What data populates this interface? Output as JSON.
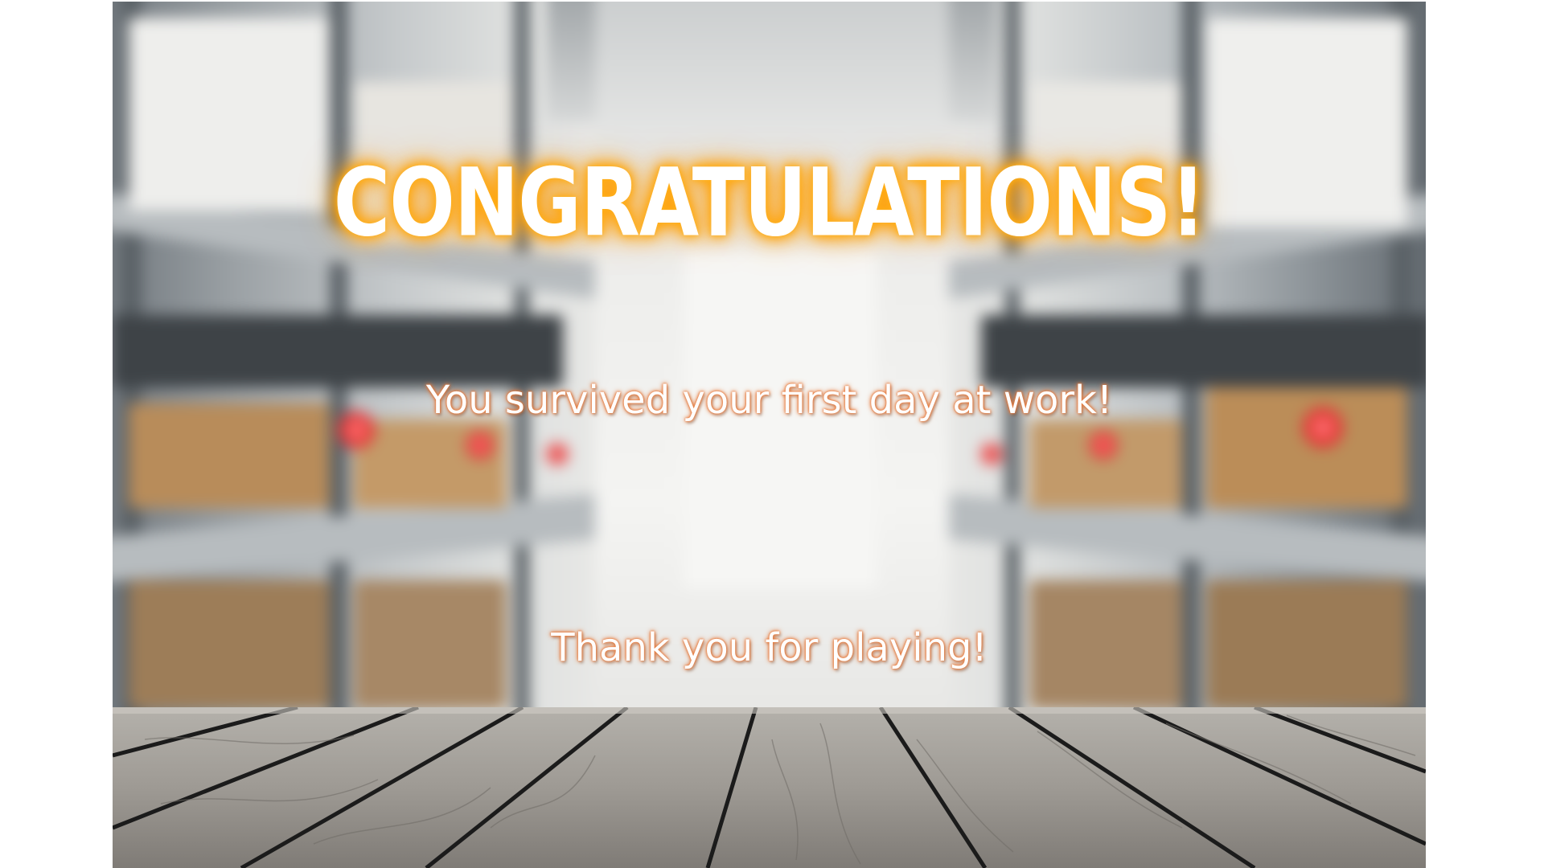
{
  "screen": {
    "title": "CONGRATULATIONS!",
    "message": "You survived your first day at work!",
    "thanks": "Thank you for playing!"
  },
  "colors": {
    "title_text": "#ffffff",
    "title_glow": "#ffa400",
    "message_text": "#ffffff",
    "message_outline": "#e8793a",
    "page_background": "#ffffff"
  },
  "background": {
    "scene": "blurred-warehouse-aisle",
    "foreground": "wooden-table-planks"
  }
}
